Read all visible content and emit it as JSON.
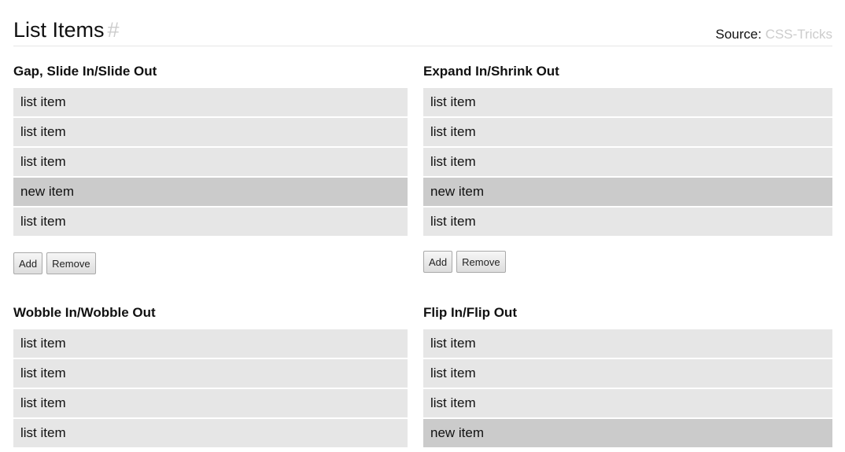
{
  "header": {
    "title": "List Items",
    "anchor": "#",
    "source_label": "Source:",
    "source_link": "CSS-Tricks"
  },
  "sections": [
    {
      "heading": "Gap, Slide In/Slide Out",
      "items": [
        {
          "label": "list item",
          "new": false
        },
        {
          "label": "list item",
          "new": false
        },
        {
          "label": "list item",
          "new": false
        },
        {
          "label": "new item",
          "new": true
        },
        {
          "label": "list item",
          "new": false
        }
      ],
      "add_label": "Add",
      "remove_label": "Remove"
    },
    {
      "heading": "Expand In/Shrink Out",
      "items": [
        {
          "label": "list item",
          "new": false
        },
        {
          "label": "list item",
          "new": false
        },
        {
          "label": "list item",
          "new": false
        },
        {
          "label": "new item",
          "new": true
        },
        {
          "label": "list item",
          "new": false
        }
      ],
      "add_label": "Add",
      "remove_label": "Remove"
    },
    {
      "heading": "Wobble In/Wobble Out",
      "items": [
        {
          "label": "list item",
          "new": false
        },
        {
          "label": "list item",
          "new": false
        },
        {
          "label": "list item",
          "new": false
        },
        {
          "label": "list item",
          "new": false
        }
      ]
    },
    {
      "heading": "Flip In/Flip Out",
      "items": [
        {
          "label": "list item",
          "new": false
        },
        {
          "label": "list item",
          "new": false
        },
        {
          "label": "list item",
          "new": false
        },
        {
          "label": "new item",
          "new": true
        }
      ]
    }
  ],
  "colors": {
    "item_bg": "#e6e6e6",
    "new_item_bg": "#cbcbcb",
    "muted_text": "#cccccc"
  }
}
